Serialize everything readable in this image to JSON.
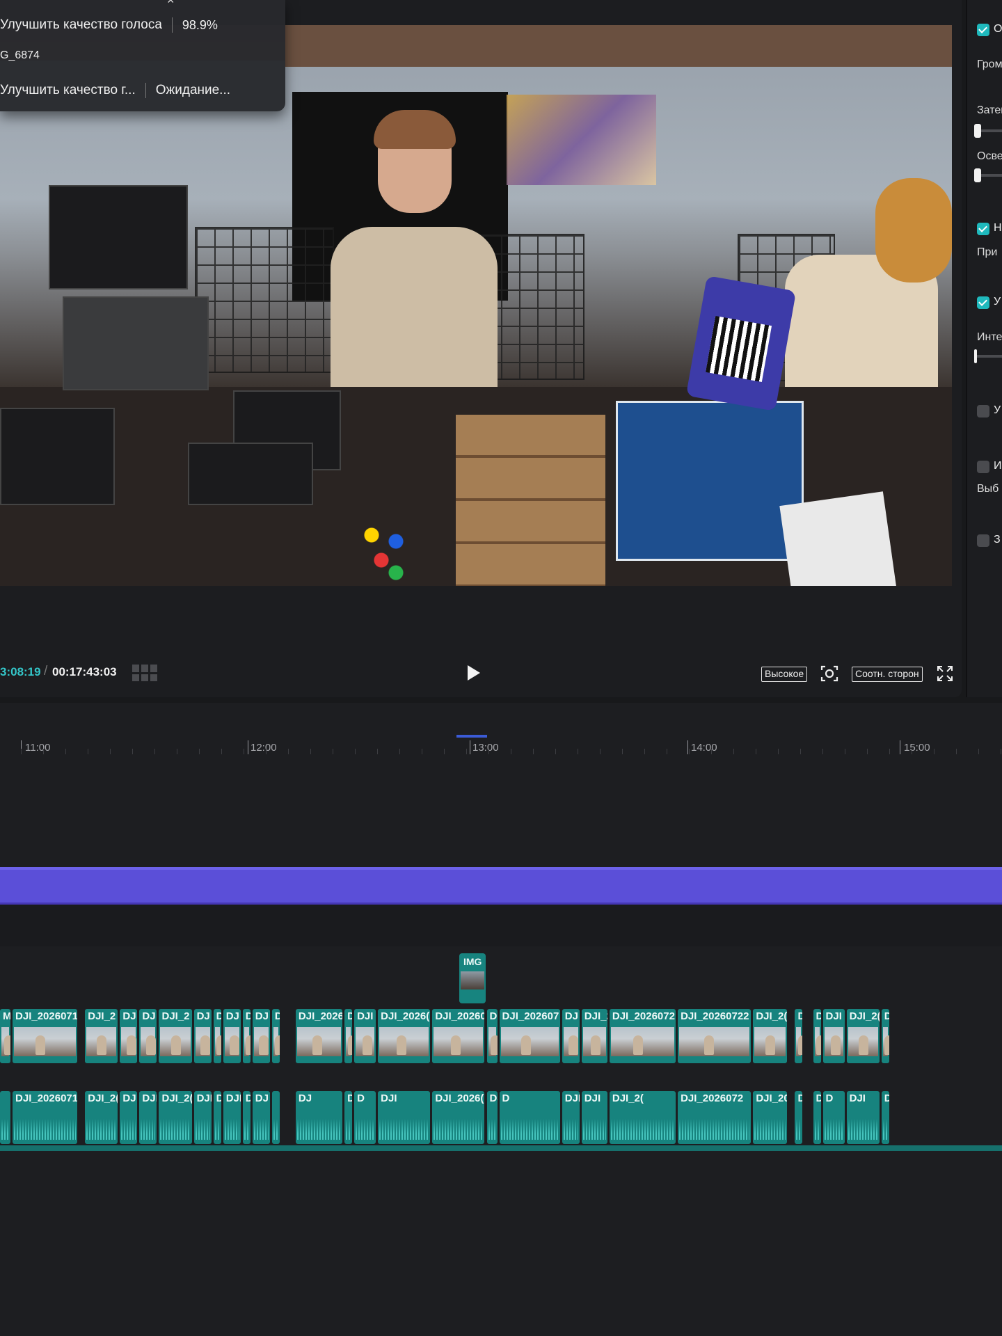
{
  "export_popup": {
    "rows": [
      {
        "name": "Улучшить качество голоса",
        "status": "98.9%"
      },
      {
        "name": "G_6874",
        "status": ""
      },
      {
        "name": "Улучшить качество г...",
        "status": "Ожидание..."
      }
    ]
  },
  "player": {
    "current_time": "3:08:19",
    "separator": "/",
    "total_time": "00:17:43:03",
    "quality_label": "Высокое",
    "aspect_label": "Соотн. сторон"
  },
  "inspector": {
    "items": [
      {
        "head": "О",
        "checked": true
      },
      {
        "label": "Гром"
      },
      {
        "label": "Затем"
      },
      {
        "label": "Осве"
      },
      {
        "head": "Н",
        "checked": true
      },
      {
        "label": "При"
      },
      {
        "head": "У",
        "checked": true
      },
      {
        "label": "Инте"
      },
      {
        "head": "У",
        "checked": false
      },
      {
        "head": "И",
        "checked": false
      },
      {
        "label": "Выб"
      },
      {
        "head": "З",
        "checked": false
      }
    ]
  },
  "timeline": {
    "ruler_labels": [
      "11:00",
      "12:00",
      "13:00",
      "14:00",
      "15:00"
    ],
    "image_clip_label": "IMG",
    "video_clips": [
      "M",
      "DJI_2026071",
      "DJI_2",
      "DJ",
      "DJ",
      "DJI_2",
      "DJ",
      "D",
      "DJ",
      "D",
      "DJ",
      "D",
      "DJI_2026",
      "D",
      "DJI",
      "DJI_2026(",
      "DJI_20260",
      "D",
      "DJI_202607",
      "DJ",
      "DJI_2",
      "DJI_2026072",
      "DJI_20260722",
      "DJI_2(",
      "D",
      "D",
      "DJI",
      "DJI_2(",
      "D"
    ],
    "audio_clips": [
      "",
      "DJI_2026071",
      "DJI_2(",
      "DJ",
      "DJI",
      "DJI_2(",
      "DJI",
      "D",
      "DJI",
      "D",
      "DJ",
      "",
      "DJ",
      "DJI_2026",
      "D",
      "DJI",
      "DJI_2026(",
      "DJI_20260",
      "D",
      "DJI_202607",
      "DJI",
      "DJI_2(",
      "DJI_2026072",
      "DJI_20260722",
      "DJI_2(",
      "D",
      "D",
      "DJI",
      "DJI_20",
      "D"
    ]
  },
  "colors": {
    "accent_teal": "#1fb9bd",
    "clip_teal": "#17837e",
    "audio_track_purple": "#5b4fd8",
    "timecode_current": "#34c6c9"
  }
}
